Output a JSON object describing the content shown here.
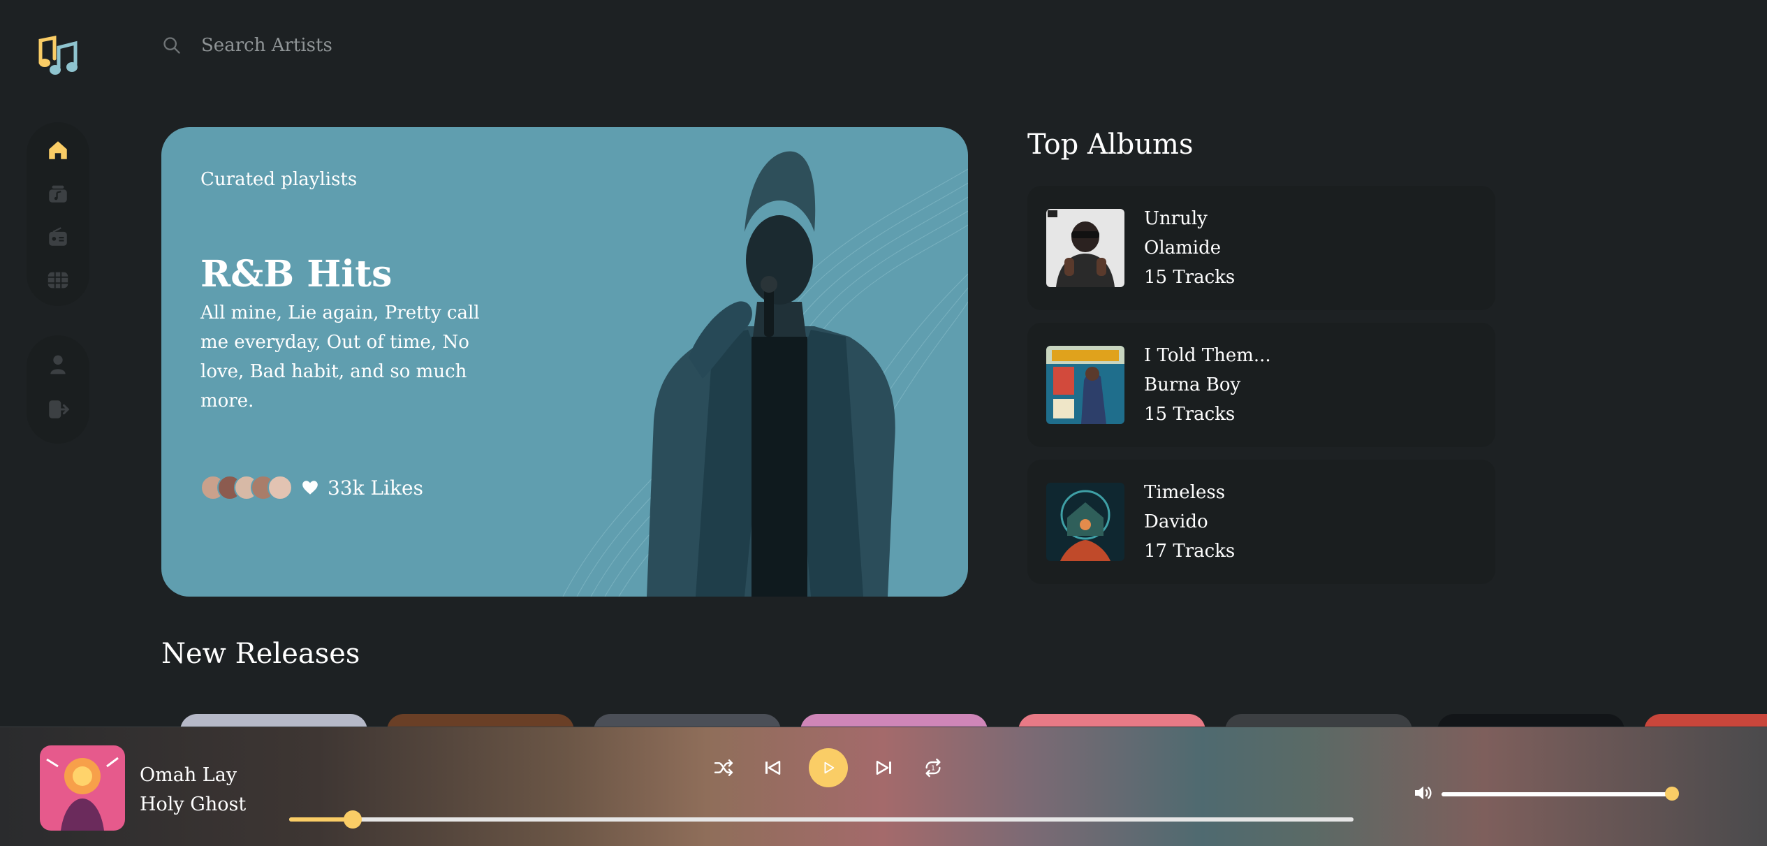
{
  "search": {
    "placeholder": "Search Artists"
  },
  "colors": {
    "accent": "#facd66",
    "background": "#1d2123",
    "hero": "#609eaf",
    "card": "#1a1e1f"
  },
  "nav": {
    "items": [
      {
        "icon": "home-icon",
        "active": true
      },
      {
        "icon": "music-library-icon",
        "active": false
      },
      {
        "icon": "radio-icon",
        "active": false
      },
      {
        "icon": "videos-icon",
        "active": false
      }
    ],
    "secondary": [
      {
        "icon": "profile-icon"
      },
      {
        "icon": "logout-icon"
      }
    ]
  },
  "hero": {
    "label": "Curated playlists",
    "title": "R&B Hits",
    "description": "All mine, Lie again, Pretty call me everyday, Out of time, No love, Bad habit, and so much more.",
    "likes": "33k Likes"
  },
  "top_albums": {
    "title": "Top Albums",
    "items": [
      {
        "title": "Unruly",
        "artist": "Olamide",
        "tracks": "15 Tracks"
      },
      {
        "title": "I Told Them...",
        "artist": "Burna Boy",
        "tracks": "15 Tracks"
      },
      {
        "title": "Timeless",
        "artist": "Davido",
        "tracks": "17 Tracks"
      }
    ]
  },
  "new_releases": {
    "title": "New Releases"
  },
  "player": {
    "artist": "Omah Lay",
    "song": "Holy Ghost",
    "progress": 0.06,
    "volume": 1.0
  }
}
